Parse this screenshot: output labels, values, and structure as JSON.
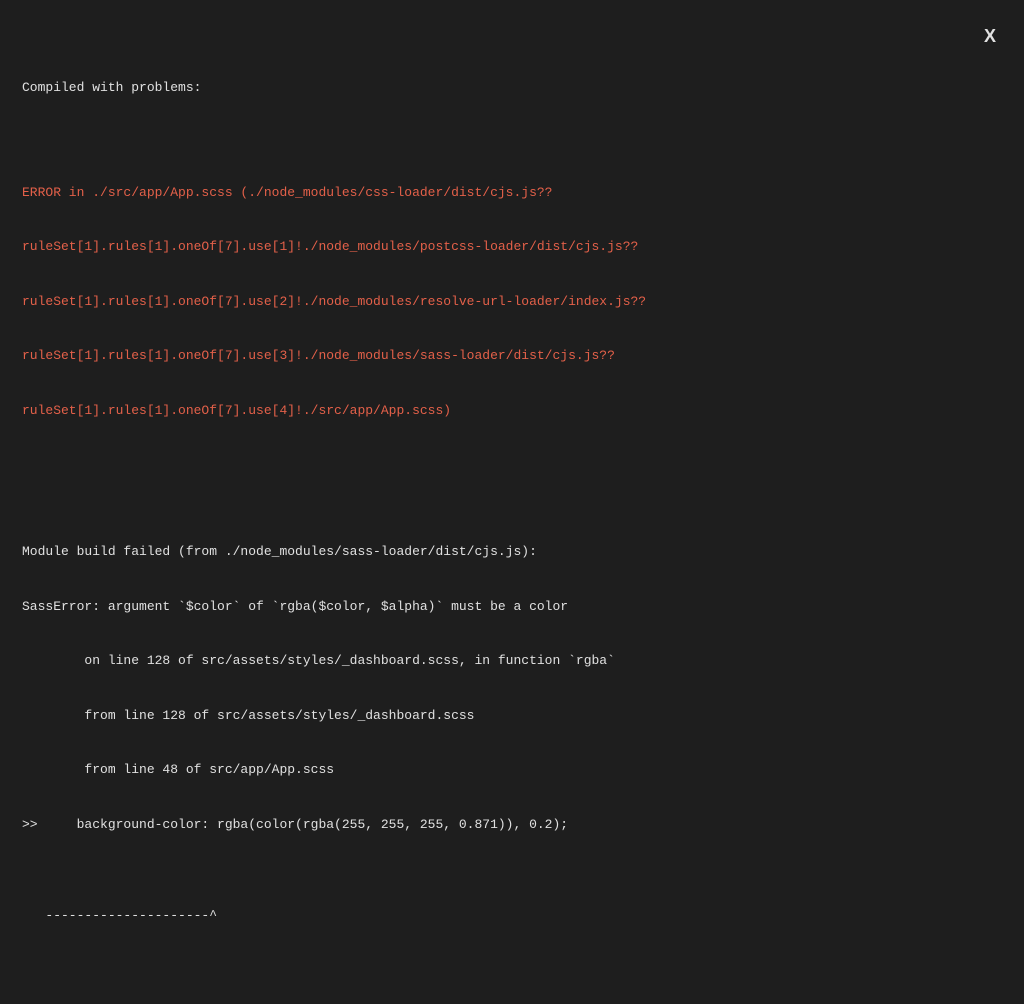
{
  "header": "Compiled with problems:",
  "close_label": "X",
  "error_lines": [
    "ERROR in ./src/app/App.scss (./node_modules/css-loader/dist/cjs.js??",
    "ruleSet[1].rules[1].oneOf[7].use[1]!./node_modules/postcss-loader/dist/cjs.js??",
    "ruleSet[1].rules[1].oneOf[7].use[2]!./node_modules/resolve-url-loader/index.js??",
    "ruleSet[1].rules[1].oneOf[7].use[3]!./node_modules/sass-loader/dist/cjs.js??",
    "ruleSet[1].rules[1].oneOf[7].use[4]!./src/app/App.scss)"
  ],
  "message_lines": [
    "Module build failed (from ./node_modules/sass-loader/dist/cjs.js):",
    "SassError: argument `$color` of `rgba($color, $alpha)` must be a color",
    "        on line 128 of src/assets/styles/_dashboard.scss, in function `rgba`",
    "        from line 128 of src/assets/styles/_dashboard.scss",
    "        from line 48 of src/app/App.scss",
    ">>     background-color: rgba(color(rgba(255, 255, 255, 0.871)), 0.2);",
    "",
    "   ---------------------^"
  ]
}
